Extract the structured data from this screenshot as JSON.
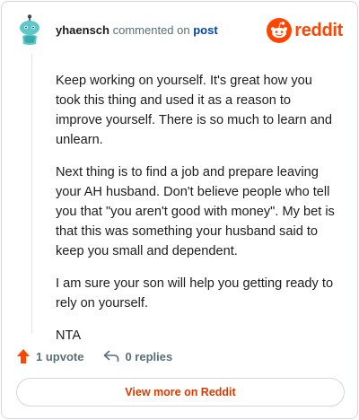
{
  "header": {
    "author": "yhaensch",
    "action_text": "commented on",
    "post_link": "post",
    "brand": "reddit",
    "brand_color": "#ff4500",
    "avatar_icon": "snoo-avatar-icon"
  },
  "comment": {
    "paragraphs": [
      "Keep working on yourself. It's great how you took this thing and used it as a reason to improve yourself. There is so much to learn and unlearn.",
      "Next thing is to find a job and prepare leaving your AH husband. Don't believe people who tell you that \"you aren't good with money\". My bet is that this was something your husband said to keep you small and dependent.",
      "I am sure your son will help you getting ready to rely on yourself.",
      "NTA"
    ]
  },
  "actions": {
    "upvote_label": "1 upvote",
    "upvote_icon": "upvote-arrow-icon",
    "replies_label": "0 replies",
    "replies_icon": "reply-arrow-icon"
  },
  "footer": {
    "view_more_label": "View more on Reddit",
    "accent_color": "#d93a00"
  }
}
